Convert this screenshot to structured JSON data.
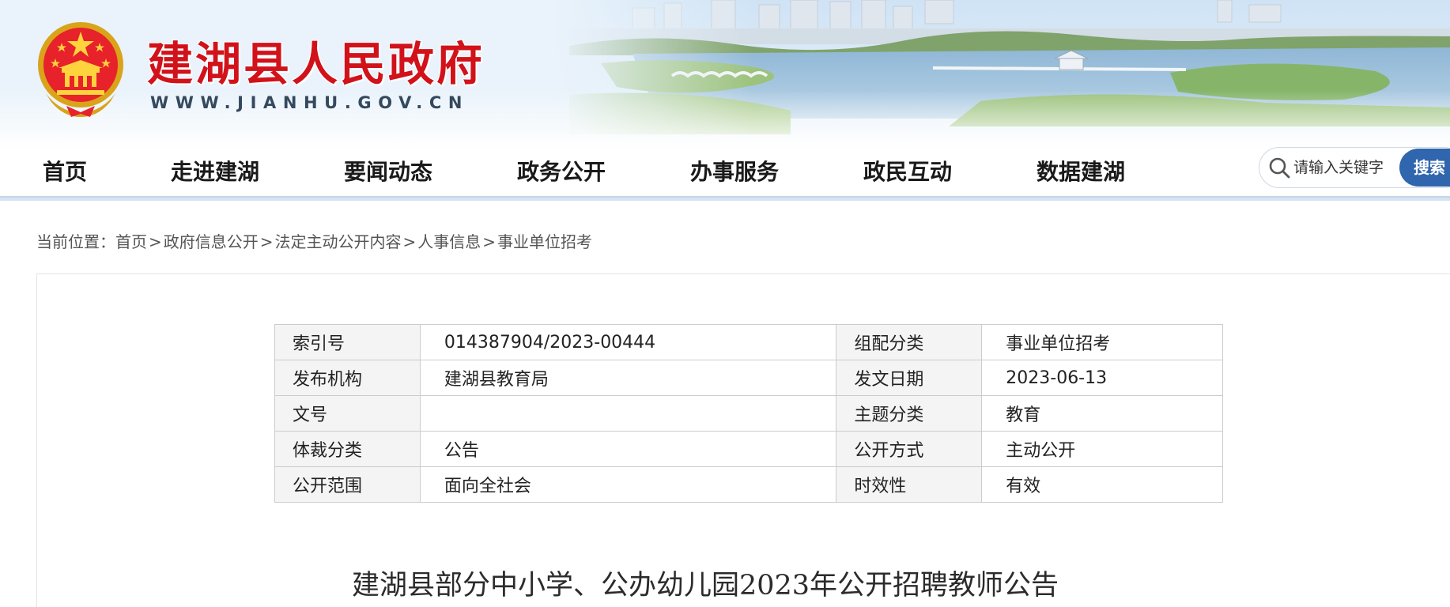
{
  "header": {
    "site_name": "建湖县人民政府",
    "site_url": "WWW.JIANHU.GOV.CN",
    "emblem_icon": "national-emblem-icon"
  },
  "nav": {
    "items": [
      {
        "label": "首页"
      },
      {
        "label": "走进建湖"
      },
      {
        "label": "要闻动态"
      },
      {
        "label": "政务公开"
      },
      {
        "label": "办事服务"
      },
      {
        "label": "政民互动"
      },
      {
        "label": "数据建湖"
      }
    ]
  },
  "search": {
    "placeholder": "请输入关键字",
    "button_label": "搜索"
  },
  "breadcrumb": {
    "prefix": "当前位置：",
    "items": [
      "首页",
      "政府信息公开",
      "法定主动公开内容",
      "人事信息",
      "事业单位招考"
    ],
    "separator": ">"
  },
  "meta_table": {
    "rows": [
      {
        "k1": "索引号",
        "v1": "014387904/2023-00444",
        "k2": "组配分类",
        "v2": "事业单位招考"
      },
      {
        "k1": "发布机构",
        "v1": "建湖县教育局",
        "k2": "发文日期",
        "v2": "2023-06-13"
      },
      {
        "k1": "文号",
        "v1": "",
        "k2": "主题分类",
        "v2": "教育"
      },
      {
        "k1": "体裁分类",
        "v1": "公告",
        "k2": "公开方式",
        "v2": "主动公开"
      },
      {
        "k1": "公开范围",
        "v1": "面向全社会",
        "k2": "时效性",
        "v2": "有效"
      }
    ]
  },
  "document": {
    "title": "建湖县部分中小学、公办幼儿园2023年公开招聘教师公告"
  },
  "colors": {
    "title_red": "#d1121a",
    "search_blue": "#2f66ad",
    "nav_line": "#d6e3f2"
  }
}
